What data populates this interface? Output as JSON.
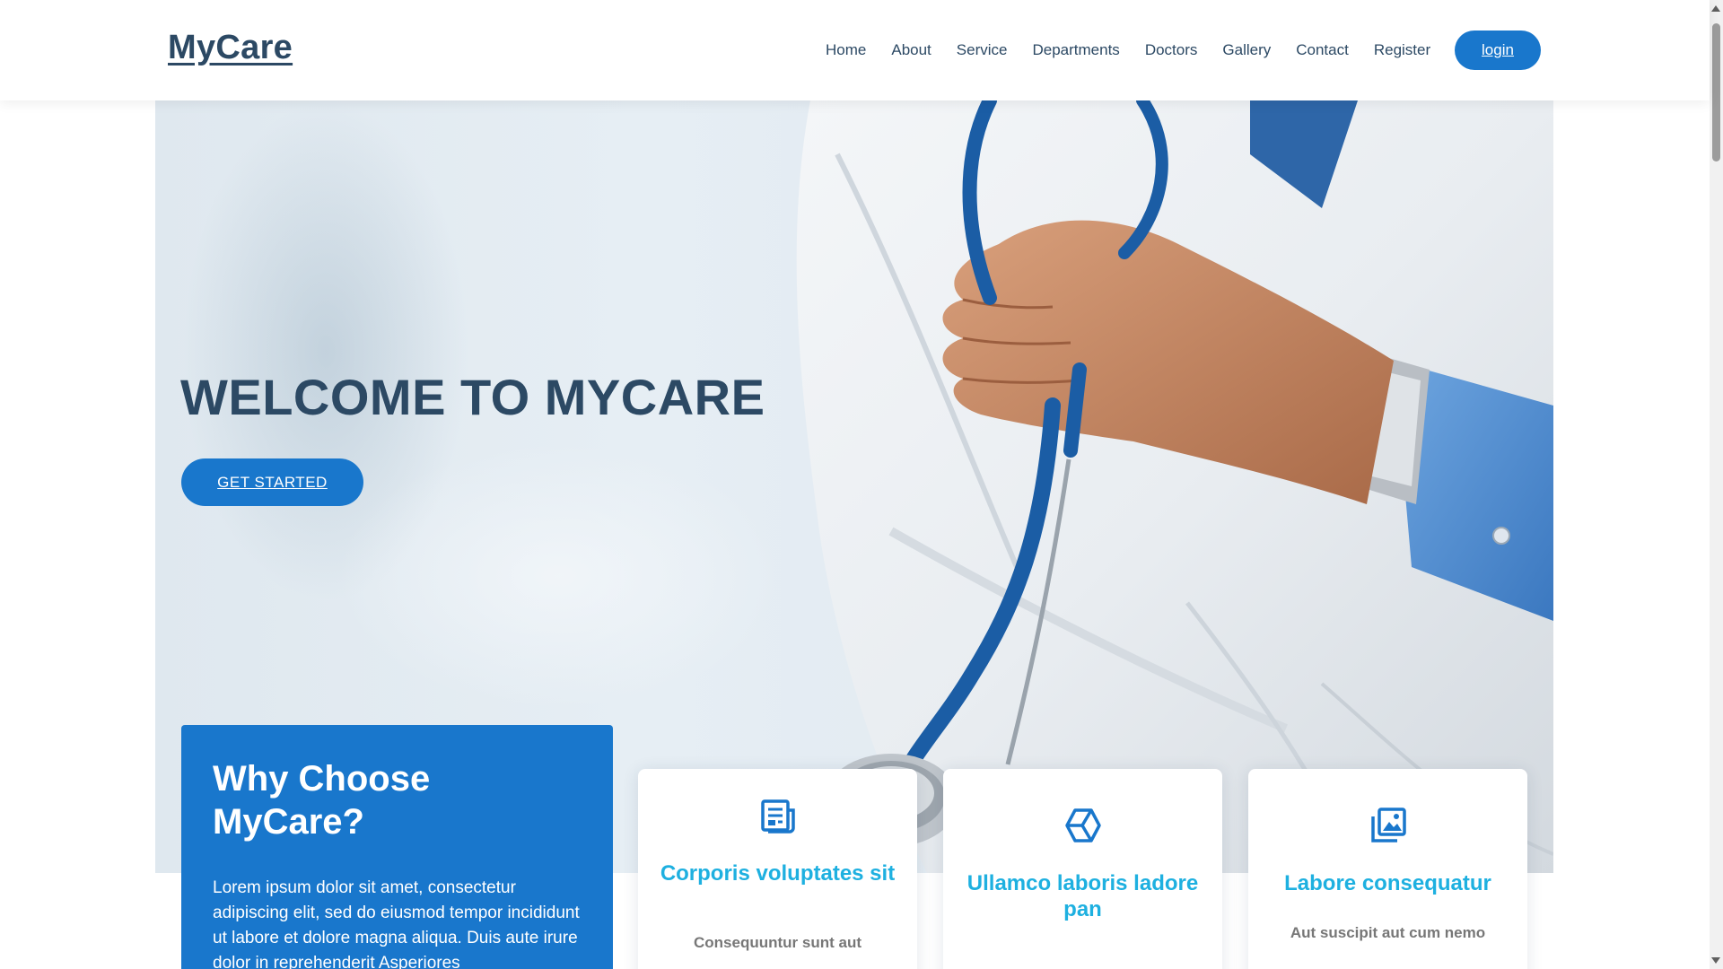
{
  "header": {
    "logo": "MyCare",
    "nav": [
      "Home",
      "About",
      "Service",
      "Departments",
      "Doctors",
      "Gallery",
      "Contact",
      "Register"
    ],
    "login_label": "login"
  },
  "hero": {
    "title": "WELCOME TO MYCARE",
    "cta_label": "GET STARTED"
  },
  "why": {
    "title": "Why Choose MyCare?",
    "text": "Lorem ipsum dolor sit amet, consectetur adipiscing elit, sed do eiusmod tempor incididunt ut labore et dolore magna aliqua. Duis aute irure dolor in reprehenderit Asperiores"
  },
  "cards": [
    {
      "icon": "document-icon",
      "title": "Corporis voluptates sit",
      "text": "Consequuntur sunt aut"
    },
    {
      "icon": "cube-icon",
      "title": "Ullamco laboris ladore pan",
      "text": ""
    },
    {
      "icon": "images-icon",
      "title": "Labore consequatur",
      "text": "Aut suscipit aut cum nemo"
    }
  ],
  "colors": {
    "primary": "#1977cc",
    "heading": "#2c4964",
    "card_title": "#1eb0e0"
  }
}
